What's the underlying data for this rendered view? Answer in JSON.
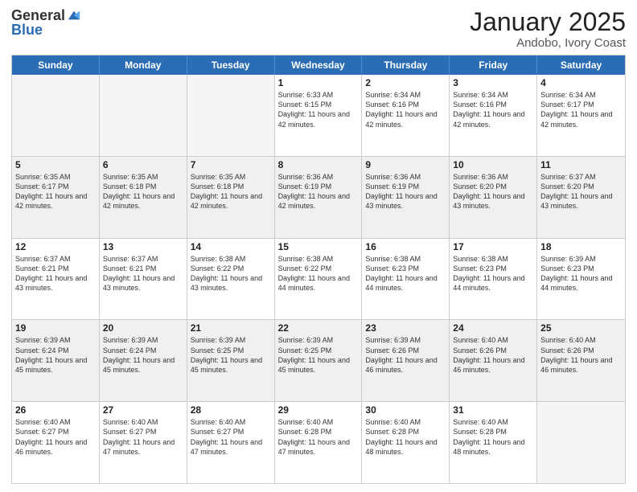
{
  "header": {
    "logo_general": "General",
    "logo_blue": "Blue",
    "title": "January 2025",
    "subtitle": "Andobo, Ivory Coast"
  },
  "calendar": {
    "days_of_week": [
      "Sunday",
      "Monday",
      "Tuesday",
      "Wednesday",
      "Thursday",
      "Friday",
      "Saturday"
    ],
    "weeks": [
      [
        {
          "day": "",
          "empty": true
        },
        {
          "day": "",
          "empty": true
        },
        {
          "day": "",
          "empty": true
        },
        {
          "day": "1",
          "sunrise": "6:33 AM",
          "sunset": "6:15 PM",
          "daylight": "11 hours and 42 minutes."
        },
        {
          "day": "2",
          "sunrise": "6:34 AM",
          "sunset": "6:16 PM",
          "daylight": "11 hours and 42 minutes."
        },
        {
          "day": "3",
          "sunrise": "6:34 AM",
          "sunset": "6:16 PM",
          "daylight": "11 hours and 42 minutes."
        },
        {
          "day": "4",
          "sunrise": "6:34 AM",
          "sunset": "6:17 PM",
          "daylight": "11 hours and 42 minutes."
        }
      ],
      [
        {
          "day": "5",
          "sunrise": "6:35 AM",
          "sunset": "6:17 PM",
          "daylight": "11 hours and 42 minutes."
        },
        {
          "day": "6",
          "sunrise": "6:35 AM",
          "sunset": "6:18 PM",
          "daylight": "11 hours and 42 minutes."
        },
        {
          "day": "7",
          "sunrise": "6:35 AM",
          "sunset": "6:18 PM",
          "daylight": "11 hours and 42 minutes."
        },
        {
          "day": "8",
          "sunrise": "6:36 AM",
          "sunset": "6:19 PM",
          "daylight": "11 hours and 42 minutes."
        },
        {
          "day": "9",
          "sunrise": "6:36 AM",
          "sunset": "6:19 PM",
          "daylight": "11 hours and 43 minutes."
        },
        {
          "day": "10",
          "sunrise": "6:36 AM",
          "sunset": "6:20 PM",
          "daylight": "11 hours and 43 minutes."
        },
        {
          "day": "11",
          "sunrise": "6:37 AM",
          "sunset": "6:20 PM",
          "daylight": "11 hours and 43 minutes."
        }
      ],
      [
        {
          "day": "12",
          "sunrise": "6:37 AM",
          "sunset": "6:21 PM",
          "daylight": "11 hours and 43 minutes."
        },
        {
          "day": "13",
          "sunrise": "6:37 AM",
          "sunset": "6:21 PM",
          "daylight": "11 hours and 43 minutes."
        },
        {
          "day": "14",
          "sunrise": "6:38 AM",
          "sunset": "6:22 PM",
          "daylight": "11 hours and 43 minutes."
        },
        {
          "day": "15",
          "sunrise": "6:38 AM",
          "sunset": "6:22 PM",
          "daylight": "11 hours and 44 minutes."
        },
        {
          "day": "16",
          "sunrise": "6:38 AM",
          "sunset": "6:23 PM",
          "daylight": "11 hours and 44 minutes."
        },
        {
          "day": "17",
          "sunrise": "6:38 AM",
          "sunset": "6:23 PM",
          "daylight": "11 hours and 44 minutes."
        },
        {
          "day": "18",
          "sunrise": "6:39 AM",
          "sunset": "6:23 PM",
          "daylight": "11 hours and 44 minutes."
        }
      ],
      [
        {
          "day": "19",
          "sunrise": "6:39 AM",
          "sunset": "6:24 PM",
          "daylight": "11 hours and 45 minutes."
        },
        {
          "day": "20",
          "sunrise": "6:39 AM",
          "sunset": "6:24 PM",
          "daylight": "11 hours and 45 minutes."
        },
        {
          "day": "21",
          "sunrise": "6:39 AM",
          "sunset": "6:25 PM",
          "daylight": "11 hours and 45 minutes."
        },
        {
          "day": "22",
          "sunrise": "6:39 AM",
          "sunset": "6:25 PM",
          "daylight": "11 hours and 45 minutes."
        },
        {
          "day": "23",
          "sunrise": "6:39 AM",
          "sunset": "6:26 PM",
          "daylight": "11 hours and 46 minutes."
        },
        {
          "day": "24",
          "sunrise": "6:40 AM",
          "sunset": "6:26 PM",
          "daylight": "11 hours and 46 minutes."
        },
        {
          "day": "25",
          "sunrise": "6:40 AM",
          "sunset": "6:26 PM",
          "daylight": "11 hours and 46 minutes."
        }
      ],
      [
        {
          "day": "26",
          "sunrise": "6:40 AM",
          "sunset": "6:27 PM",
          "daylight": "11 hours and 46 minutes."
        },
        {
          "day": "27",
          "sunrise": "6:40 AM",
          "sunset": "6:27 PM",
          "daylight": "11 hours and 47 minutes."
        },
        {
          "day": "28",
          "sunrise": "6:40 AM",
          "sunset": "6:27 PM",
          "daylight": "11 hours and 47 minutes."
        },
        {
          "day": "29",
          "sunrise": "6:40 AM",
          "sunset": "6:28 PM",
          "daylight": "11 hours and 47 minutes."
        },
        {
          "day": "30",
          "sunrise": "6:40 AM",
          "sunset": "6:28 PM",
          "daylight": "11 hours and 48 minutes."
        },
        {
          "day": "31",
          "sunrise": "6:40 AM",
          "sunset": "6:28 PM",
          "daylight": "11 hours and 48 minutes."
        },
        {
          "day": "",
          "empty": true
        }
      ]
    ]
  }
}
